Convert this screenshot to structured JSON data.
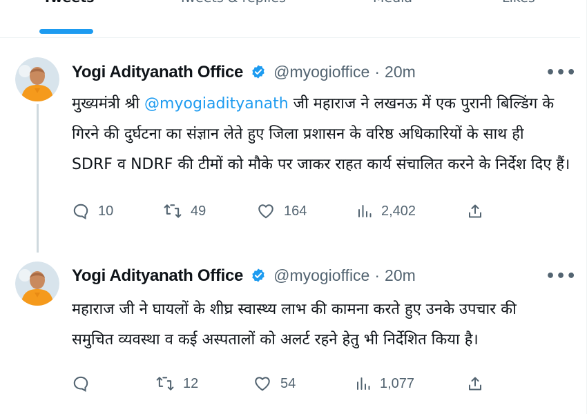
{
  "tabs": [
    {
      "label": "Tweets",
      "active": true
    },
    {
      "label": "Tweets & replies",
      "active": false
    },
    {
      "label": "Media",
      "active": false
    },
    {
      "label": "Likes",
      "active": false
    }
  ],
  "tweets": [
    {
      "author_name": "Yogi Adityanath Office",
      "handle": "@myogioffice",
      "separator": "·",
      "time": "20m",
      "more_label": "•••",
      "text_line1_pre": "मुख्यमंत्री श्री ",
      "text_line1_mention": "@myogiadityanath",
      "text_line1_post": " जी महाराज ने लखनऊ में एक पुरानी बिल्डिंग के",
      "text_line2": "गिरने की दुर्घटना का संज्ञान लेते हुए जिला प्रशासन के वरिष्ठ अधिकारियों के साथ ही",
      "text_line3": "SDRF व NDRF की टीमों को मौके पर जाकर राहत कार्य संचालित करने के निर्देश दिए हैं।",
      "replies": "10",
      "retweets": "49",
      "likes": "164",
      "views": "2,402"
    },
    {
      "author_name": "Yogi Adityanath Office",
      "handle": "@myogioffice",
      "separator": "·",
      "time": "20m",
      "more_label": "•••",
      "text_line1": "महाराज जी ने घायलों के शीघ्र स्वास्थ्य लाभ की कामना करते हुए उनके उपचार की",
      "text_line2": "समुचित व्यवस्था व कई अस्पतालों को अलर्ट रहने हेतु भी निर्देशित किया है।",
      "replies": "",
      "retweets": "12",
      "likes": "54",
      "views": "1,077"
    }
  ],
  "colors": {
    "accent": "#1d9bf0",
    "text_primary": "#0f1419",
    "text_secondary": "#536471",
    "avatar_bg": "#f2a33a"
  },
  "icons": [
    "verified-badge-icon",
    "more-icon",
    "reply-icon",
    "retweet-icon",
    "like-icon",
    "views-icon",
    "share-icon"
  ]
}
